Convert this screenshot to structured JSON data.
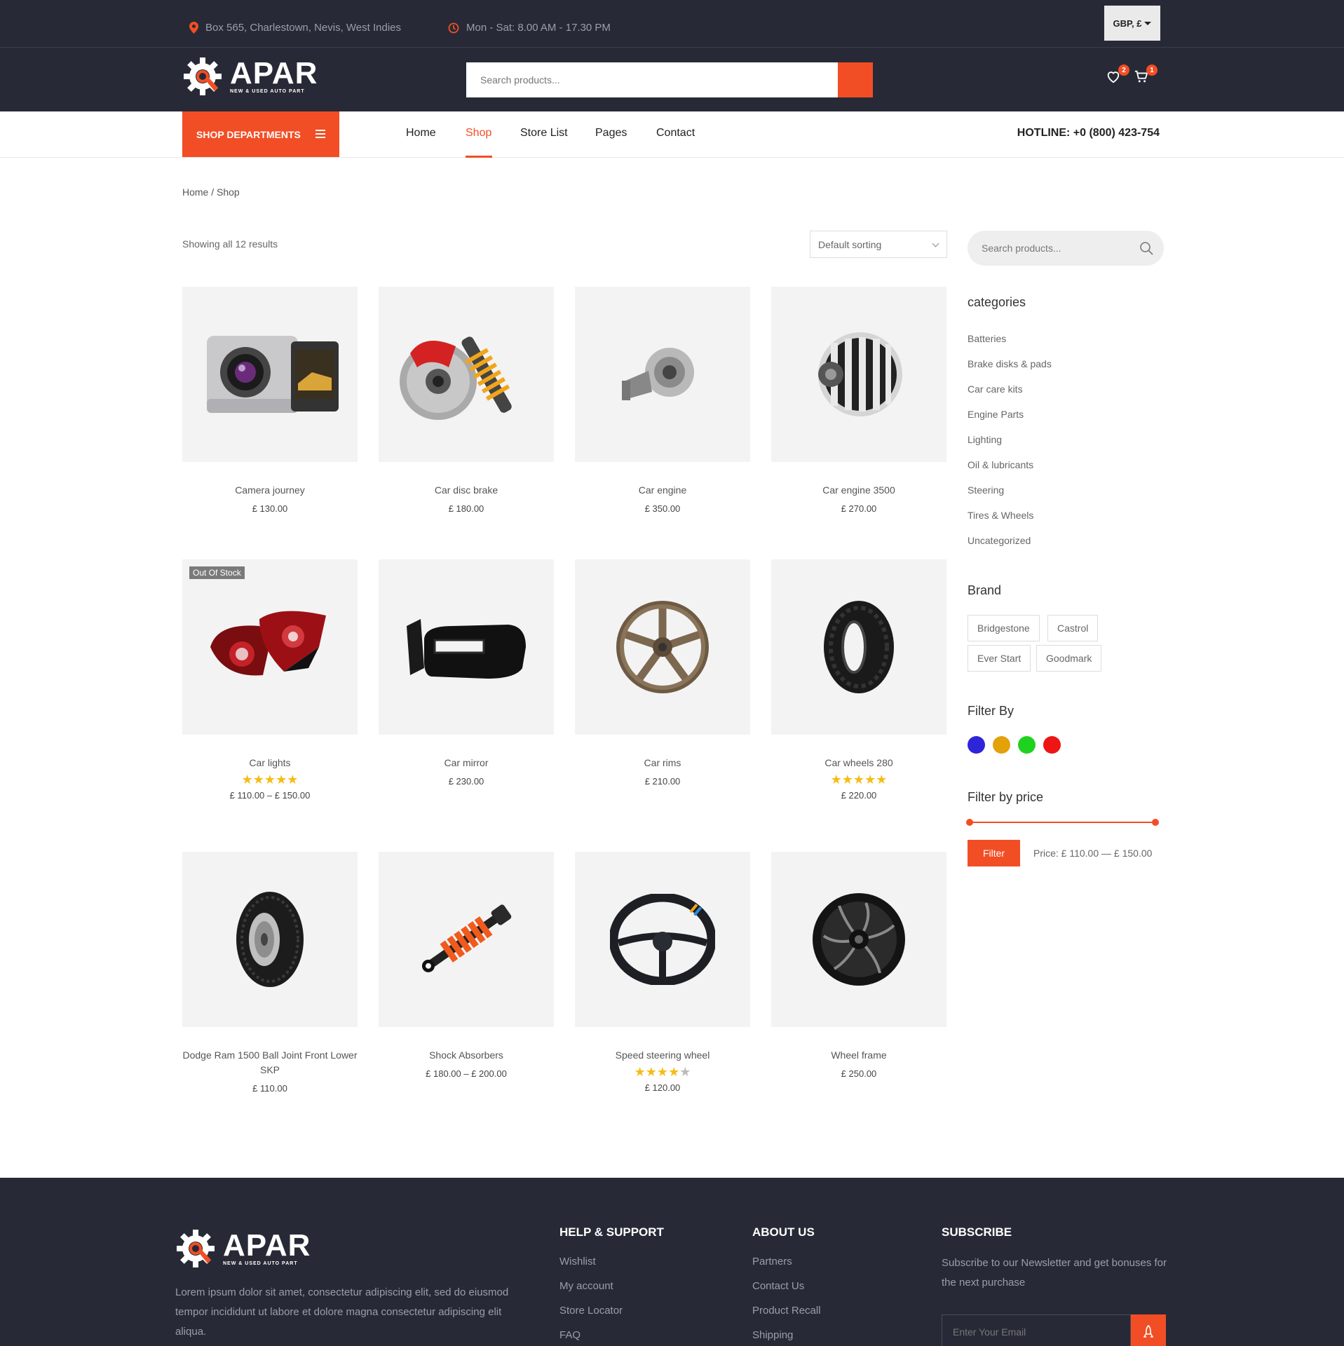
{
  "topbar": {
    "address": "Box 565, Charlestown, Nevis, West Indies",
    "hours": "Mon - Sat: 8.00 AM - 17.30 PM",
    "currency": "GBP, £"
  },
  "brand": {
    "name": "APAR",
    "tagline": "NEW & USED AUTO PART"
  },
  "header": {
    "search_placeholder": "Search products...",
    "wishlist_count": "2",
    "cart_count": "1"
  },
  "nav": {
    "departments": "SHOP DEPARTMENTS",
    "items": [
      "Home",
      "Shop",
      "Store List",
      "Pages",
      "Contact"
    ],
    "active": "Shop",
    "hotline": "HOTLINE: +0 (800) 423-754"
  },
  "breadcrumb": "Home / Shop",
  "results": "Showing all 12 results",
  "sorting": "Default sorting",
  "products": [
    {
      "name": "Camera journey",
      "price": "£ 130.00"
    },
    {
      "name": "Car disc brake",
      "price": "£ 180.00"
    },
    {
      "name": "Car engine",
      "price": "£ 350.00"
    },
    {
      "name": "Car engine 3500",
      "price": "£ 270.00"
    },
    {
      "name": "Car lights",
      "price": "£ 110.00 – £ 150.00",
      "rating": 5,
      "badge": "Out Of Stock"
    },
    {
      "name": "Car mirror",
      "price": "£ 230.00"
    },
    {
      "name": "Car rims",
      "price": "£ 210.00"
    },
    {
      "name": "Car wheels 280",
      "price": "£ 220.00",
      "rating": 5
    },
    {
      "name": "Dodge Ram 1500 Ball Joint Front Lower SKP",
      "price": "£ 110.00"
    },
    {
      "name": "Shock Absorbers",
      "price": "£ 180.00 – £ 200.00"
    },
    {
      "name": "Speed steering wheel",
      "price": "£ 120.00",
      "rating": 4
    },
    {
      "name": "Wheel frame",
      "price": "£ 250.00"
    }
  ],
  "sidebar": {
    "search_placeholder": "Search products...",
    "categories_title": "categories",
    "categories": [
      "Batteries",
      "Brake disks & pads",
      "Car care kits",
      "Engine Parts",
      "Lighting",
      "Oil & lubricants",
      "Steering",
      "Tires & Wheels",
      "Uncategorized"
    ],
    "brand_title": "Brand",
    "brands": [
      "Bridgestone",
      "Castrol",
      "Ever Start",
      "Goodmark"
    ],
    "filter_title": "Filter By",
    "colors": [
      "#2f25d8",
      "#e3a10a",
      "#1fd21f",
      "#ee1515"
    ],
    "price_title": "Filter by price",
    "filter_button": "Filter",
    "price_range": "Price: £ 110.00 — £ 150.00"
  },
  "footer": {
    "description": "Lorem ipsum dolor sit amet, consectetur adipiscing elit, sed do eiusmod tempor incididunt ut labore et dolore magna consectetur adipiscing elit aliqua.",
    "help_title": "HELP & SUPPORT",
    "help_links": [
      "Wishlist",
      "My account",
      "Store Locator",
      "FAQ"
    ],
    "about_title": "ABOUT US",
    "about_links": [
      "Partners",
      "Contact Us",
      "Product Recall",
      "Shipping"
    ],
    "subscribe_title": "SUBSCRIBE",
    "subscribe_text": "Subscribe to our Newsletter and get bonuses for the next purchase",
    "email_placeholder": "Enter Your Email"
  },
  "colors": {
    "accent": "#f24e25",
    "dark": "#272a36"
  }
}
